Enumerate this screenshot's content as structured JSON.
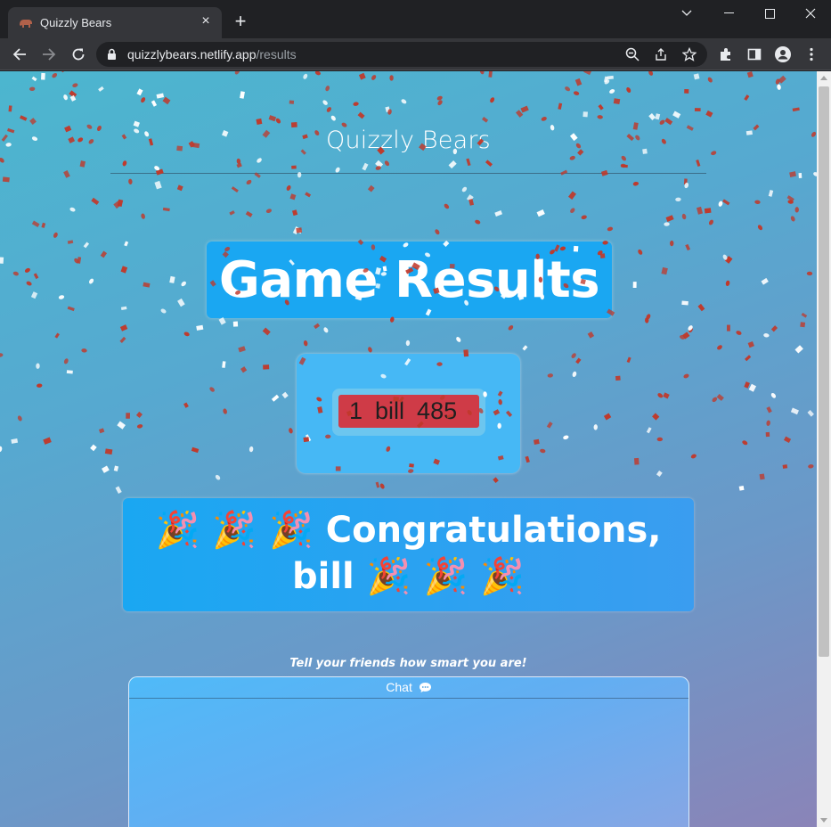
{
  "browser": {
    "tab_title": "Quizzly Bears",
    "url_host": "quizzlybears.netlify.app",
    "url_path": "/results"
  },
  "page": {
    "brand": "Quizzly Bears",
    "results_heading": "Game Results",
    "score": {
      "rank": "1",
      "name": "bill",
      "points": "485"
    },
    "congrats": {
      "party_emoji": "🎉",
      "line1_text": "Congratulations,",
      "line2_name": "bill"
    },
    "tell_friends": "Tell your friends how smart you are!",
    "chat": {
      "label": "Chat",
      "icon": "speech-bubble-icon"
    }
  },
  "colors": {
    "accent_blue": "#1aa7f2",
    "score_red": "#cf3b47",
    "confetti_red": "#c0392b",
    "confetti_white": "#ffffff"
  }
}
